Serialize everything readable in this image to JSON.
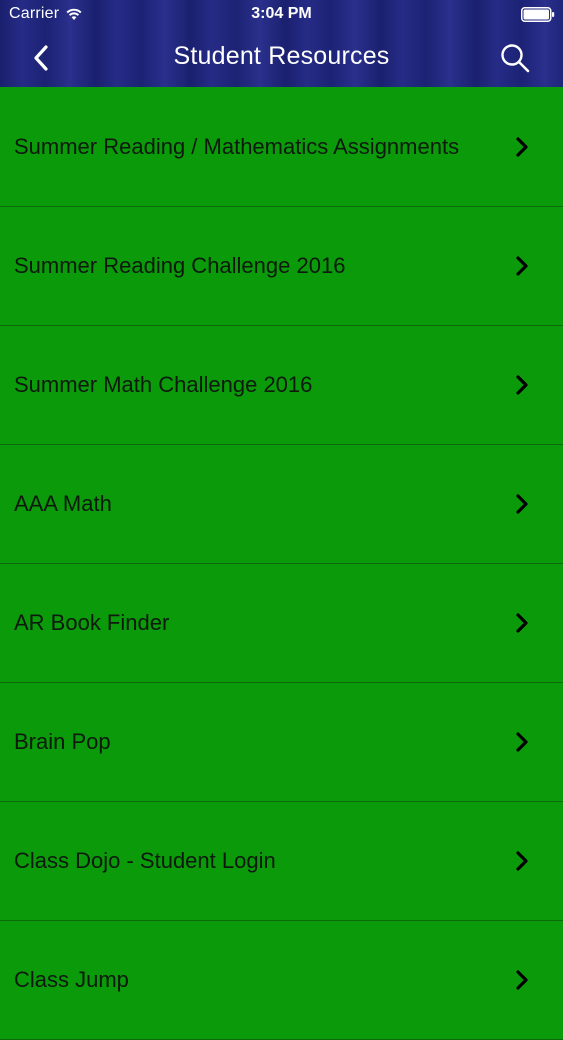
{
  "status_bar": {
    "carrier": "Carrier",
    "time": "3:04 PM"
  },
  "nav": {
    "title": "Student Resources",
    "back_icon": "chevron-left-icon",
    "search_icon": "search-icon"
  },
  "colors": {
    "header_bg": "#1f2579",
    "list_bg": "#0a9a0a",
    "divider": "#0b6a0b",
    "text": "#0d1a0d"
  },
  "resources": [
    {
      "label": "Summer Reading / Mathematics Assignments"
    },
    {
      "label": "Summer Reading Challenge 2016"
    },
    {
      "label": "Summer Math Challenge 2016"
    },
    {
      "label": "AAA Math"
    },
    {
      "label": "AR Book Finder"
    },
    {
      "label": "Brain Pop"
    },
    {
      "label": "Class Dojo - Student Login"
    },
    {
      "label": "Class Jump"
    }
  ]
}
